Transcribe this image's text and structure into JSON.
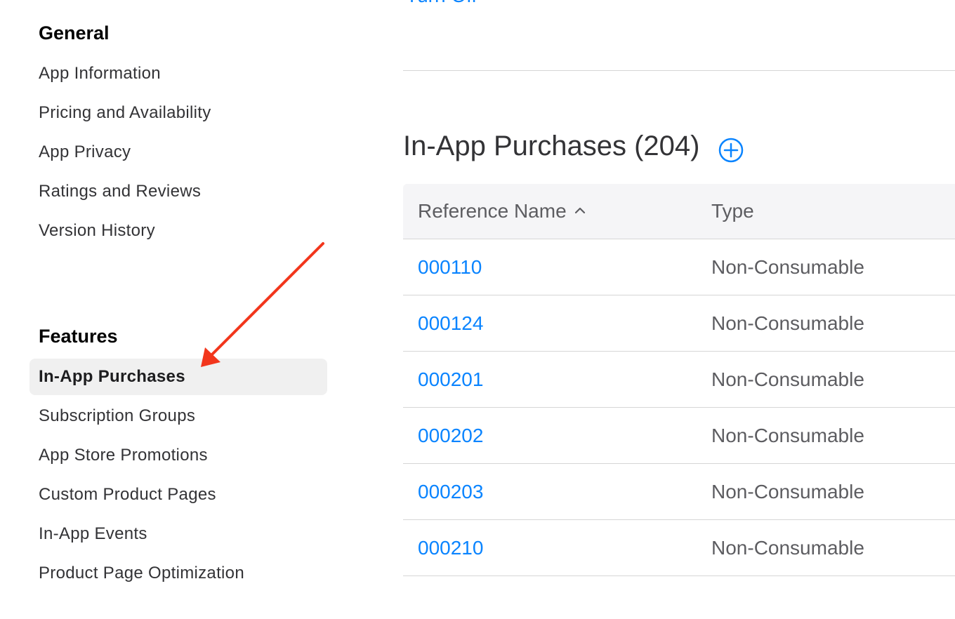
{
  "sidebar": {
    "general_title": "General",
    "general_items": [
      {
        "label": "App Information"
      },
      {
        "label": "Pricing and Availability"
      },
      {
        "label": "App Privacy"
      },
      {
        "label": "Ratings and Reviews"
      },
      {
        "label": "Version History"
      }
    ],
    "features_title": "Features",
    "feature_items": [
      {
        "label": "In-App Purchases",
        "selected": true
      },
      {
        "label": "Subscription Groups"
      },
      {
        "label": "App Store Promotions"
      },
      {
        "label": "Custom Product Pages"
      },
      {
        "label": "In-App Events"
      },
      {
        "label": "Product Page Optimization"
      }
    ]
  },
  "main": {
    "top_link": "Turn Off",
    "title": "In-App Purchases (204)",
    "add_icon": "plus-circle-icon",
    "table": {
      "columns": [
        "Reference Name",
        "Type"
      ],
      "sort_icon": "chevron-up-icon",
      "rows": [
        {
          "name": "000110",
          "type": "Non-Consumable"
        },
        {
          "name": "000124",
          "type": "Non-Consumable"
        },
        {
          "name": "000201",
          "type": "Non-Consumable"
        },
        {
          "name": "000202",
          "type": "Non-Consumable"
        },
        {
          "name": "000203",
          "type": "Non-Consumable"
        },
        {
          "name": "000210",
          "type": "Non-Consumable"
        }
      ]
    }
  },
  "colors": {
    "link": "#0a84ff",
    "selected_bg": "#f0f0f0",
    "header_bg": "#f5f5f7",
    "annotation_arrow": "#f2361c"
  }
}
